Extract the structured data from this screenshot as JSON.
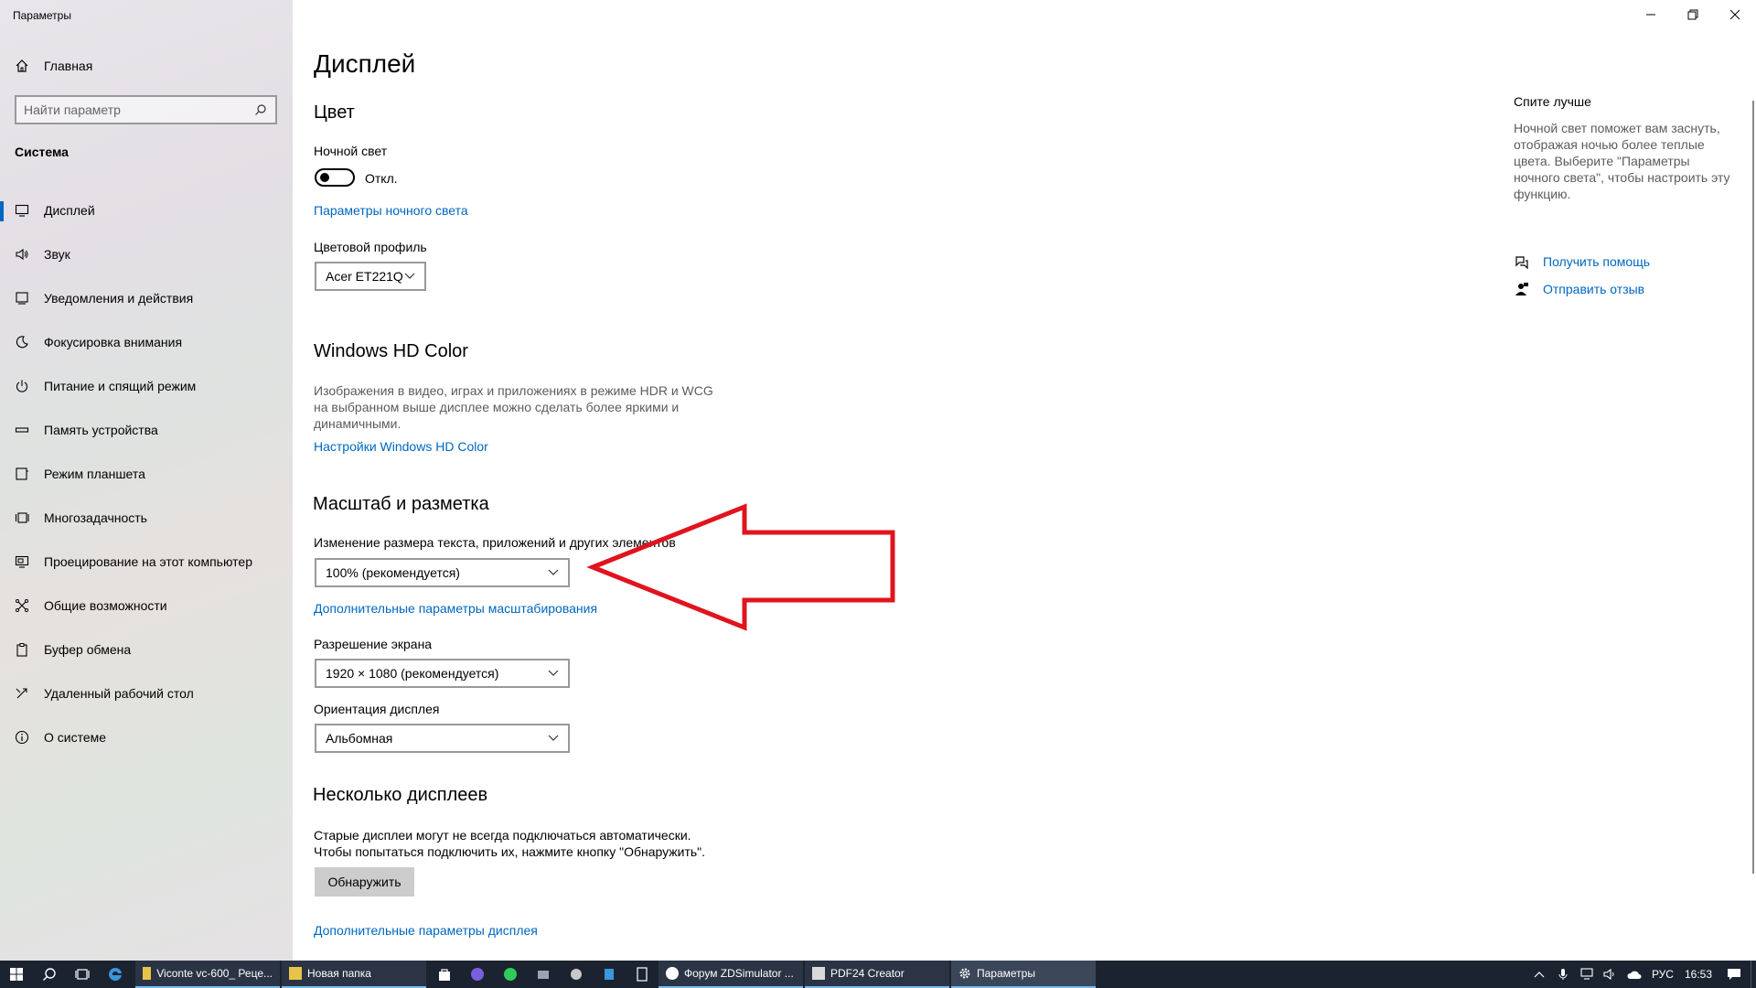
{
  "window": {
    "title": "Параметры"
  },
  "sidebar": {
    "home": "Главная",
    "search_placeholder": "Найти параметр",
    "section": "Система",
    "items": [
      {
        "label": "Дисплей",
        "icon": "monitor-icon",
        "active": true
      },
      {
        "label": "Звук",
        "icon": "speaker-icon"
      },
      {
        "label": "Уведомления и действия",
        "icon": "notification-icon"
      },
      {
        "label": "Фокусировка внимания",
        "icon": "moon-icon"
      },
      {
        "label": "Питание и спящий режим",
        "icon": "power-icon"
      },
      {
        "label": "Память устройства",
        "icon": "storage-icon"
      },
      {
        "label": "Режим планшета",
        "icon": "tablet-icon"
      },
      {
        "label": "Многозадачность",
        "icon": "multitask-icon"
      },
      {
        "label": "Проецирование на этот компьютер",
        "icon": "project-icon"
      },
      {
        "label": "Общие возможности",
        "icon": "shared-icon"
      },
      {
        "label": "Буфер обмена",
        "icon": "clipboard-icon"
      },
      {
        "label": "Удаленный рабочий стол",
        "icon": "remote-icon"
      },
      {
        "label": "О системе",
        "icon": "info-icon"
      }
    ]
  },
  "main": {
    "title": "Дисплей",
    "color": {
      "heading": "Цвет",
      "night_light_label": "Ночной свет",
      "night_light_state": "Откл.",
      "night_light_link": "Параметры ночного света",
      "profile_label": "Цветовой профиль",
      "profile_value": "Acer ET221Q"
    },
    "hd_color": {
      "heading": "Windows HD Color",
      "desc_line1": "Изображения в видео, играх и приложениях в режиме HDR и WCG",
      "desc_line2": "на выбранном выше дисплее можно сделать более яркими и",
      "desc_line3": "динамичными.",
      "link": "Настройки Windows HD Color"
    },
    "scale": {
      "heading": "Масштаб и разметка",
      "size_label": "Изменение размера текста, приложений и других элементов",
      "size_value": "100% (рекомендуется)",
      "advanced_link": "Дополнительные параметры масштабирования",
      "resolution_label": "Разрешение экрана",
      "resolution_value": "1920 × 1080 (рекомендуется)",
      "orientation_label": "Ориентация дисплея",
      "orientation_value": "Альбомная"
    },
    "multi": {
      "heading": "Несколько дисплеев",
      "desc_line1": "Старые дисплеи могут не всегда подключаться автоматически.",
      "desc_line2": "Чтобы попытаться подключить их, нажмите кнопку \"Обнаружить\".",
      "detect_button": "Обнаружить",
      "advanced_link": "Дополнительные параметры дисплея"
    }
  },
  "right_pane": {
    "title": "Спите лучше",
    "desc_line1": "Ночной свет поможет вам заснуть,",
    "desc_line2": "отображая ночью более теплые",
    "desc_line3": "цвета. Выберите \"Параметры",
    "desc_line4": "ночного света\", чтобы настроить эту",
    "desc_line5": "функцию.",
    "help_link": "Получить помощь",
    "feedback_link": "Отправить отзыв"
  },
  "taskbar": {
    "apps": [
      {
        "label": "Viconte vc-600_ Реце...",
        "icon": "folder-icon"
      },
      {
        "label": "Новая папка",
        "icon": "folder-icon"
      },
      {
        "label": "Форум ZDSimulator ...",
        "icon": "yandex-browser-icon"
      },
      {
        "label": "PDF24 Creator",
        "icon": "pdf24-icon"
      },
      {
        "label": "Параметры",
        "icon": "settings-gear-icon"
      }
    ],
    "lang": "РУС",
    "time": "16:53"
  },
  "colors": {
    "accent": "#0067c0",
    "taskbar": "#1b2330",
    "annotation_arrow": "#e0141e"
  }
}
